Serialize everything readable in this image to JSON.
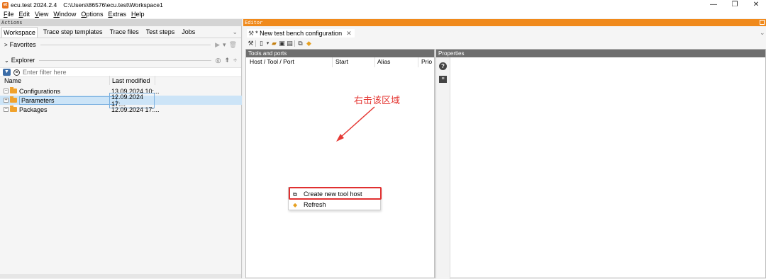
{
  "window": {
    "app": "ecu.test 2024.2.4",
    "path": "C:\\Users\\86576\\ecu.test\\Workspace1",
    "logo": "et"
  },
  "menu": [
    "File",
    "Edit",
    "View",
    "Window",
    "Options",
    "Extras",
    "Help"
  ],
  "sections": {
    "actions": "Actions",
    "editor": "Editor"
  },
  "left": {
    "tabs": [
      "Workspace",
      "Trace step templates",
      "Trace files",
      "Test steps",
      "Jobs"
    ],
    "active_tab": "Workspace",
    "favorites": "Favorites",
    "explorer": "Explorer",
    "filter_placeholder": "Enter filter here",
    "columns": {
      "name": "Name",
      "modified": "Last modified"
    },
    "items": [
      {
        "name": "Configurations",
        "modified": "13.09.2024 10:..."
      },
      {
        "name": "Parameters",
        "modified": "12.09.2024 17:..."
      },
      {
        "name": "Packages",
        "modified": "12.09.2024 17:..."
      }
    ]
  },
  "editor": {
    "tab_title": "* New test bench configuration",
    "tools_header": "Tools and ports",
    "properties_header": "Properties",
    "columns": [
      "Host / Tool / Port",
      "Start",
      "Alias",
      "Prio"
    ]
  },
  "context_menu": {
    "items": [
      "Create new tool host",
      "Refresh"
    ]
  },
  "annotation": "右击该区域",
  "colors": {
    "accent": "#f08a1c",
    "annotation": "#e53935",
    "selection": "#cce4f7"
  }
}
